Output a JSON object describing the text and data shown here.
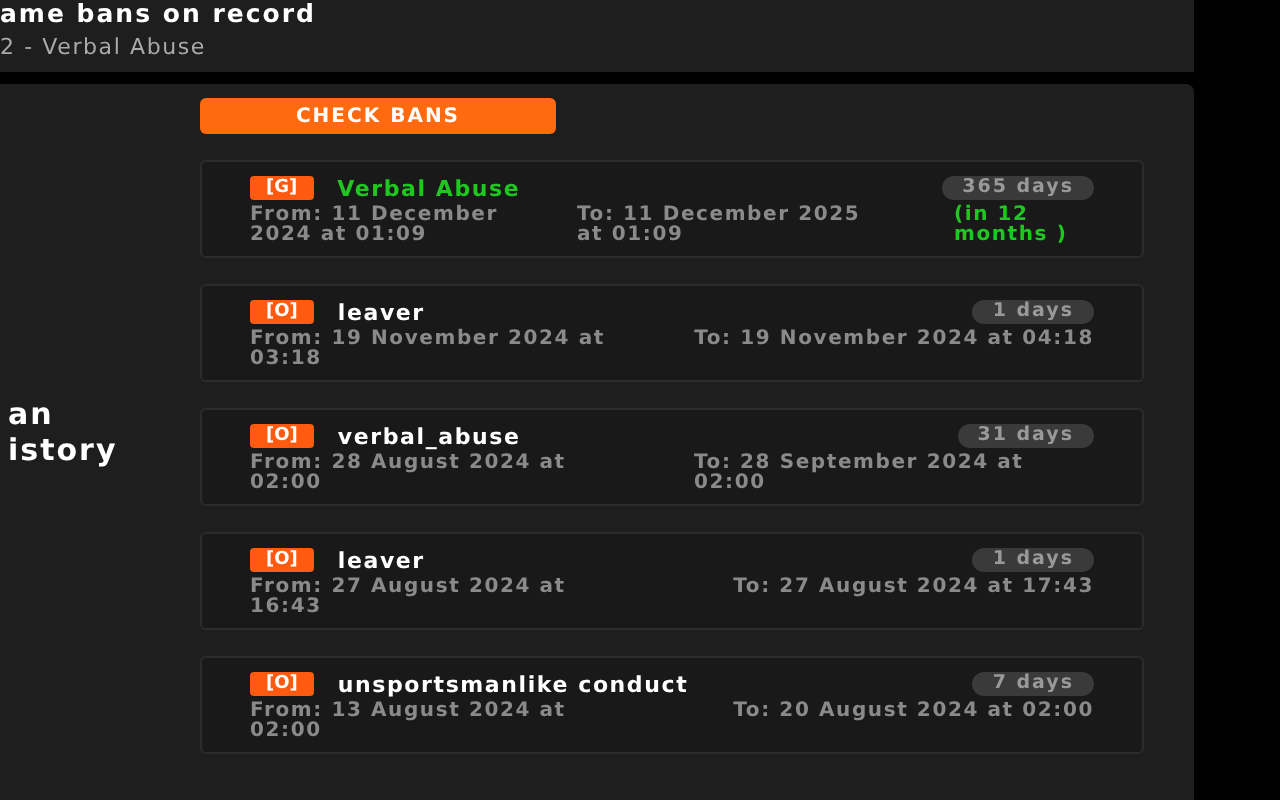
{
  "header": {
    "title": "ame bans on record",
    "subtitle": "2 - Verbal Abuse"
  },
  "section": {
    "title_lines": [
      "an",
      "istory"
    ]
  },
  "check_button": "CHECK BANS",
  "bans": [
    {
      "tag": "[G]",
      "reason": "Verbal Abuse",
      "active": true,
      "duration": "365 days",
      "from": "From: 11 December 2024 at 01:09",
      "to": "To: 11 December 2025 at 01:09",
      "relative": "(in 12 months )"
    },
    {
      "tag": "[O]",
      "reason": "leaver",
      "active": false,
      "duration": "1 days",
      "from": "From: 19 November 2024 at 03:18",
      "to": "To: 19 November 2024 at 04:18"
    },
    {
      "tag": "[O]",
      "reason": "verbal_abuse",
      "active": false,
      "duration": "31 days",
      "from": "From: 28 August 2024 at 02:00",
      "to": "To: 28 September 2024 at 02:00"
    },
    {
      "tag": "[O]",
      "reason": "leaver",
      "active": false,
      "duration": "1 days",
      "from": "From: 27 August 2024 at 16:43",
      "to": "To: 27 August 2024 at 17:43"
    },
    {
      "tag": "[O]",
      "reason": "unsportsmanlike conduct",
      "active": false,
      "duration": "7 days",
      "from": "From: 13 August 2024 at 02:00",
      "to": "To: 20 August 2024 at 02:00"
    }
  ]
}
